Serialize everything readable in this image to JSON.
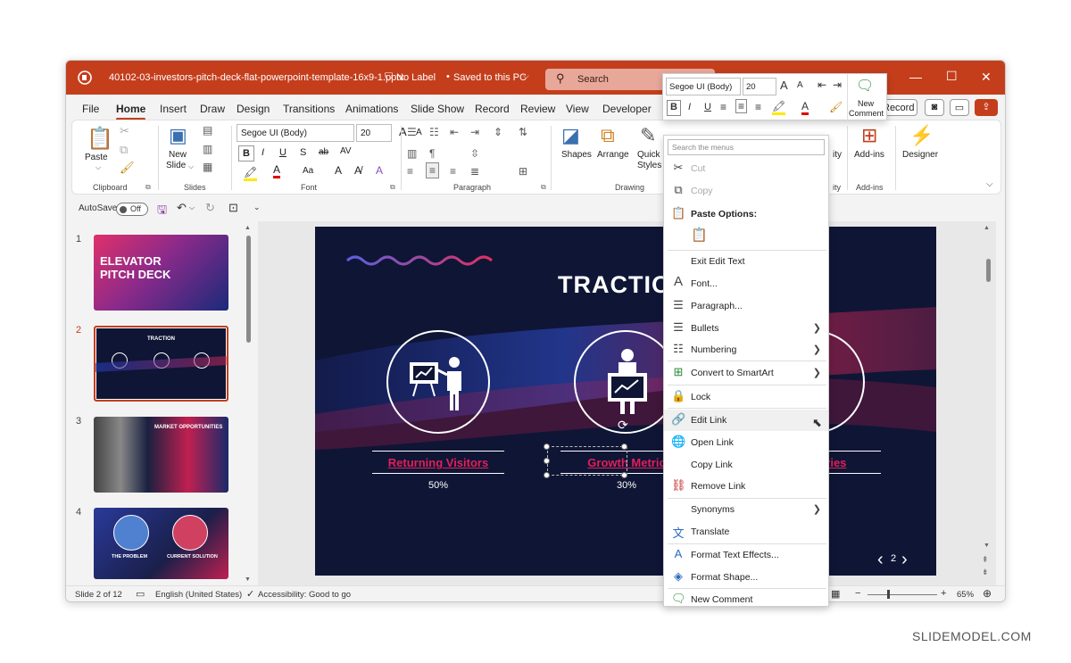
{
  "window": {
    "filename": "40102-03-investors-pitch-deck-flat-powerpoint-template-16x9-1.pptx",
    "label": "No Label",
    "saved": "Saved to this PC",
    "search_placeholder": "Search"
  },
  "menu": {
    "tabs": [
      "File",
      "Home",
      "Insert",
      "Draw",
      "Design",
      "Transitions",
      "Animations",
      "Slide Show",
      "Record",
      "Review",
      "View",
      "Developer"
    ],
    "active": "Home",
    "record_button": "Record"
  },
  "ribbon": {
    "clipboard": {
      "paste": "Paste",
      "group": "Clipboard"
    },
    "slides": {
      "new": "New",
      "slide": "Slide",
      "group": "Slides"
    },
    "font": {
      "family": "Segoe UI (Body)",
      "size": "20",
      "group": "Font",
      "bold": "B",
      "italic": "I",
      "underline": "U",
      "strike": "S",
      "shadow": "ab",
      "spacing": "AV",
      "case": "Aa",
      "grow": "A",
      "shrink": "A"
    },
    "paragraph": {
      "group": "Paragraph"
    },
    "drawing": {
      "shapes": "Shapes",
      "arrange": "Arrange",
      "quick": "Quick",
      "styles": "Styles",
      "group": "Drawing"
    },
    "addins": {
      "label": "Add-ins",
      "group": "Add-ins",
      "partial": "ity"
    },
    "designer": "Designer"
  },
  "qat": {
    "autosave": "AutoSave",
    "toggle": "Off"
  },
  "thumbnails": [
    {
      "num": "1",
      "title": "ELEVATOR PITCH DECK"
    },
    {
      "num": "2",
      "title": "TRACTION"
    },
    {
      "num": "3",
      "title": "MARKET OPPORTUNITIES"
    },
    {
      "num": "4",
      "title_left": "THE PROBLEM",
      "title_right": "CURRENT SOLUTION"
    }
  ],
  "slide": {
    "title": "TRACTIO",
    "items": [
      {
        "label": "Returning Visitors",
        "value": "50%"
      },
      {
        "label": "Growth Metric",
        "value": "30%"
      },
      {
        "label": "tories",
        "value": ""
      }
    ],
    "page": "2"
  },
  "status": {
    "slide": "Slide 2 of 12",
    "language": "English (United States)",
    "accessibility": "Accessibility: Good to go",
    "zoom": "65%"
  },
  "mini_toolbar": {
    "font": "Segoe UI (Body)",
    "size": "20",
    "new_comment_line1": "New",
    "new_comment_line2": "Comment"
  },
  "context_menu": {
    "search_placeholder": "Search the menus",
    "cut": "Cut",
    "copy": "Copy",
    "paste_options": "Paste Options:",
    "exit_edit": "Exit Edit Text",
    "font": "Font...",
    "paragraph": "Paragraph...",
    "bullets": "Bullets",
    "numbering": "Numbering",
    "smartart": "Convert to SmartArt",
    "lock": "Lock",
    "edit_link": "Edit Link",
    "open_link": "Open Link",
    "copy_link": "Copy Link",
    "remove_link": "Remove Link",
    "synonyms": "Synonyms",
    "translate": "Translate",
    "text_effects": "Format Text Effects...",
    "format_shape": "Format Shape...",
    "new_comment": "New Comment"
  },
  "watermark": "SLIDEMODEL.COM",
  "colors": {
    "accent": "#c43e1c",
    "slide_bg": "#0f1535",
    "link": "#e0205a"
  }
}
